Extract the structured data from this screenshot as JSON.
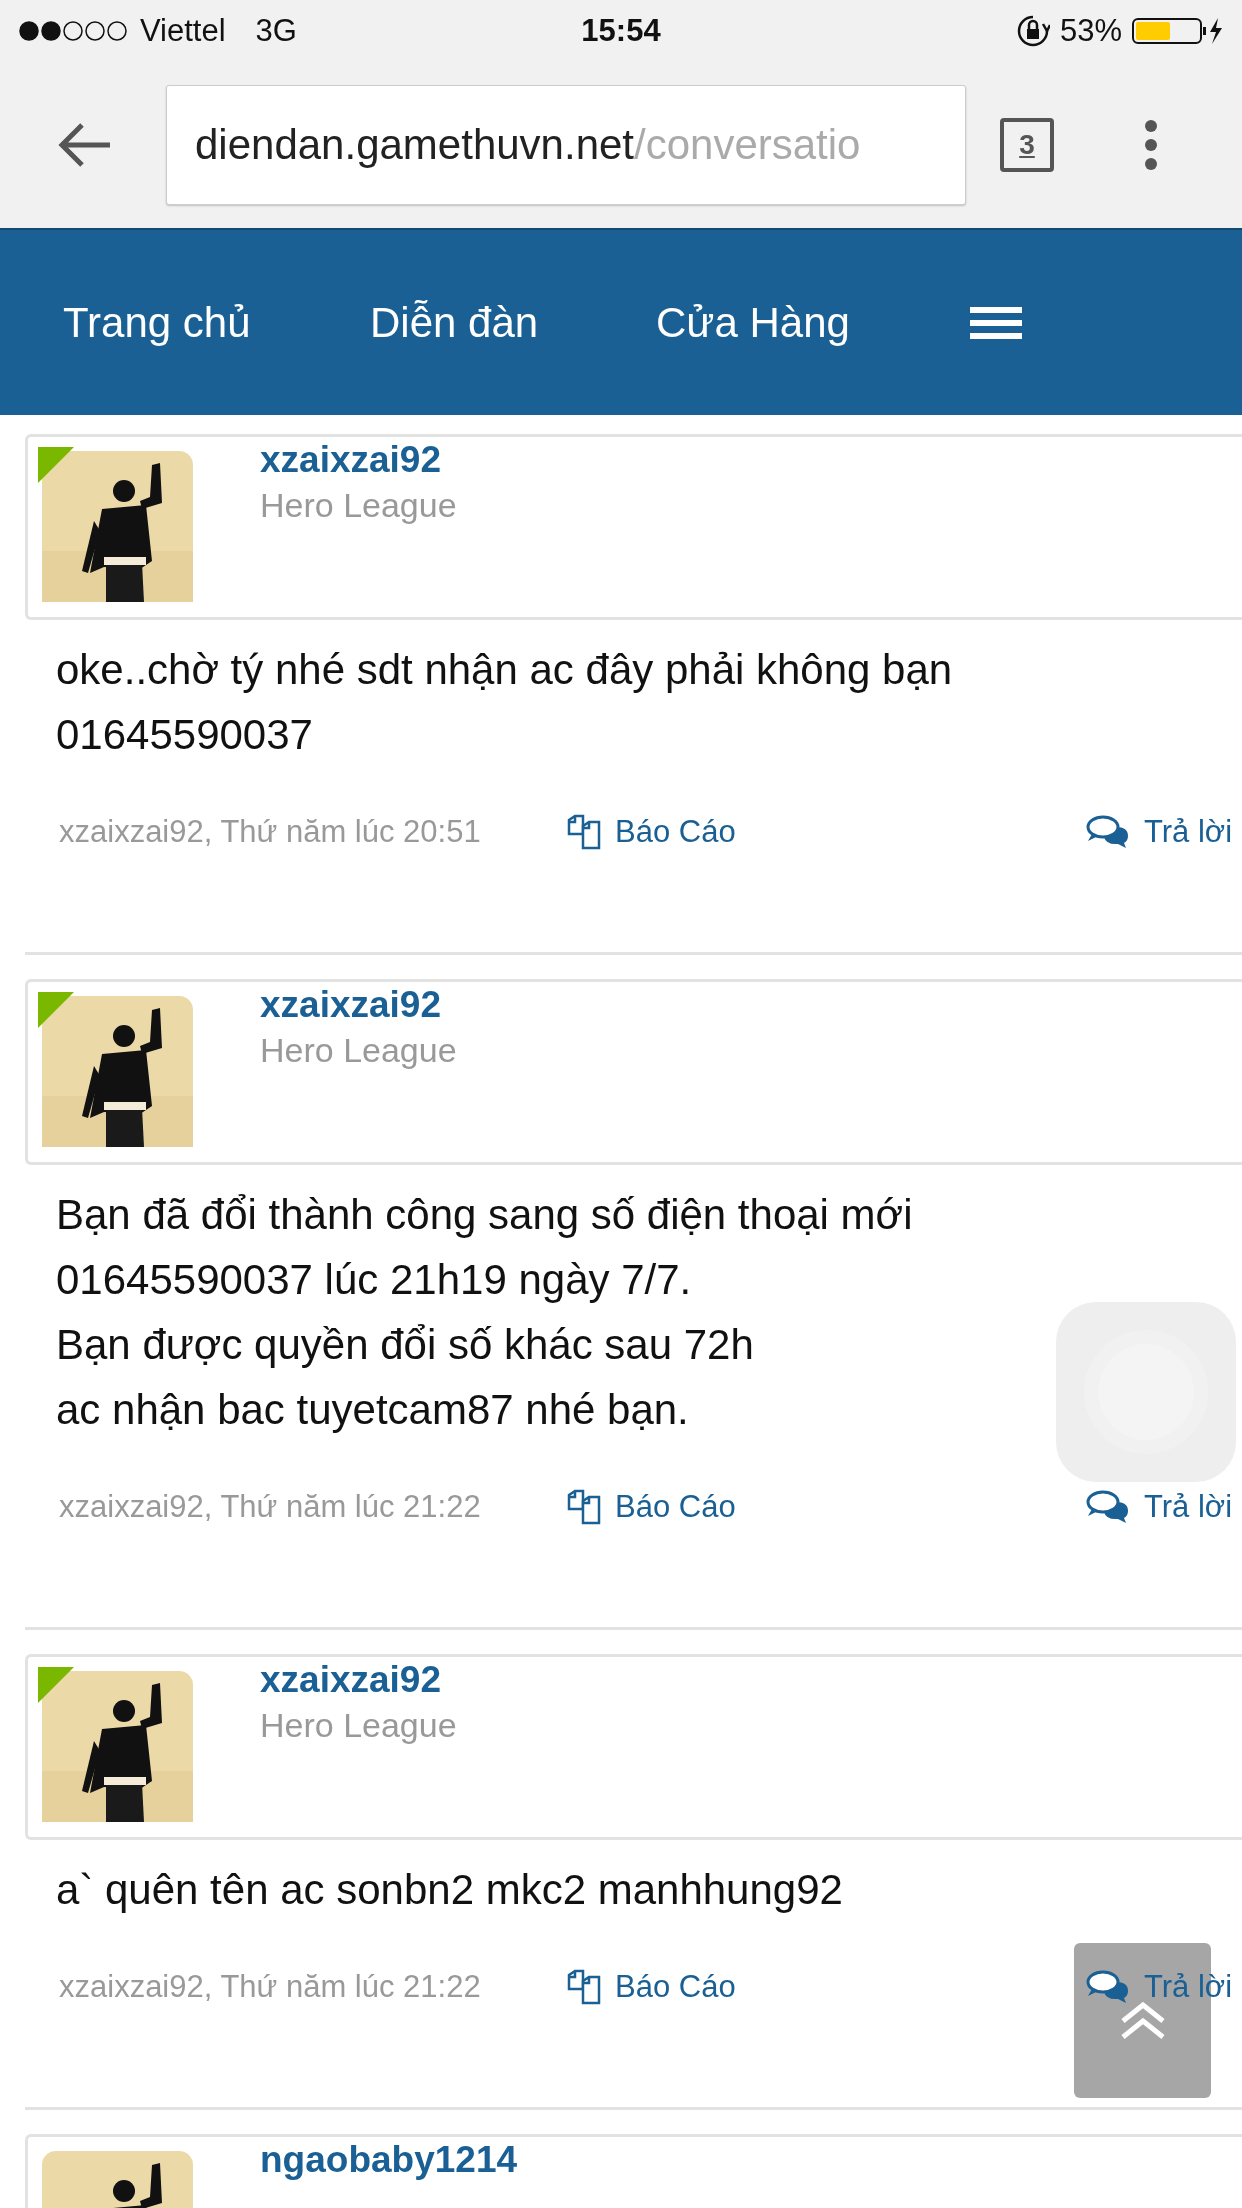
{
  "status_bar": {
    "carrier": "Viettel",
    "network": "3G",
    "time": "15:54",
    "battery": "53%"
  },
  "browser": {
    "url_host": "diendan.gamethuvn.net",
    "url_path": "/conversatio",
    "tab_count": "3"
  },
  "nav": {
    "items": [
      "Trang chủ",
      "Diễn đàn",
      "Cửa Hàng"
    ]
  },
  "posts": [
    {
      "author": "xzaixzai92",
      "rank": "Hero League",
      "online": true,
      "body": [
        "oke..chờ tý nhé sdt nhận ac đây phải không bạn",
        "01645590037"
      ],
      "meta": "xzaixzai92, Thứ năm lúc 20:51",
      "report": "Báo Cáo",
      "reply": "Trả lời"
    },
    {
      "author": "xzaixzai92",
      "rank": "Hero League",
      "online": true,
      "body": [
        "Bạn đã đổi thành công sang số điện thoại mới",
        "01645590037 lúc 21h19 ngày 7/7.",
        "Bạn được quyền đổi số khác sau 72h",
        "ac nhận bac tuyetcam87 nhé bạn."
      ],
      "meta": "xzaixzai92, Thứ năm lúc 21:22",
      "report": "Báo Cáo",
      "reply": "Trả lời"
    },
    {
      "author": "xzaixzai92",
      "rank": "Hero League",
      "online": true,
      "body": [
        "a` quên tên ac sonbn2 mkc2 manhhung92"
      ],
      "meta": "xzaixzai92, Thứ năm lúc 21:22",
      "report": "Báo Cáo",
      "reply": "Trả lời"
    },
    {
      "author": "ngaobaby1214",
      "online": false
    }
  ]
}
